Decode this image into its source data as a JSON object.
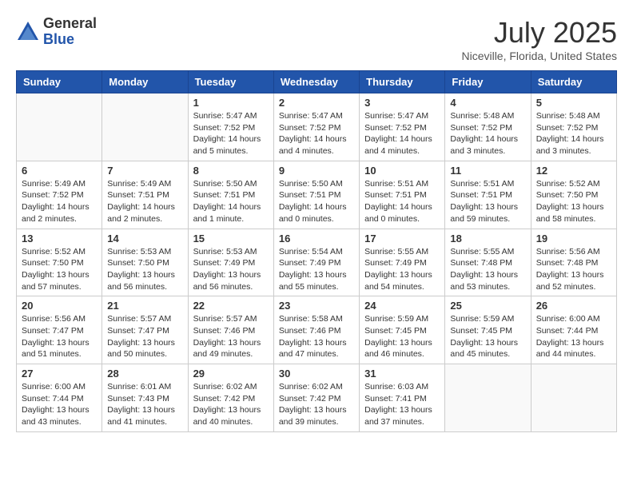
{
  "logo": {
    "general": "General",
    "blue": "Blue"
  },
  "title": {
    "month_year": "July 2025",
    "location": "Niceville, Florida, United States"
  },
  "days_of_week": [
    "Sunday",
    "Monday",
    "Tuesday",
    "Wednesday",
    "Thursday",
    "Friday",
    "Saturday"
  ],
  "weeks": [
    [
      {
        "day": "",
        "info": ""
      },
      {
        "day": "",
        "info": ""
      },
      {
        "day": "1",
        "info": "Sunrise: 5:47 AM\nSunset: 7:52 PM\nDaylight: 14 hours\nand 5 minutes."
      },
      {
        "day": "2",
        "info": "Sunrise: 5:47 AM\nSunset: 7:52 PM\nDaylight: 14 hours\nand 4 minutes."
      },
      {
        "day": "3",
        "info": "Sunrise: 5:47 AM\nSunset: 7:52 PM\nDaylight: 14 hours\nand 4 minutes."
      },
      {
        "day": "4",
        "info": "Sunrise: 5:48 AM\nSunset: 7:52 PM\nDaylight: 14 hours\nand 3 minutes."
      },
      {
        "day": "5",
        "info": "Sunrise: 5:48 AM\nSunset: 7:52 PM\nDaylight: 14 hours\nand 3 minutes."
      }
    ],
    [
      {
        "day": "6",
        "info": "Sunrise: 5:49 AM\nSunset: 7:52 PM\nDaylight: 14 hours\nand 2 minutes."
      },
      {
        "day": "7",
        "info": "Sunrise: 5:49 AM\nSunset: 7:51 PM\nDaylight: 14 hours\nand 2 minutes."
      },
      {
        "day": "8",
        "info": "Sunrise: 5:50 AM\nSunset: 7:51 PM\nDaylight: 14 hours\nand 1 minute."
      },
      {
        "day": "9",
        "info": "Sunrise: 5:50 AM\nSunset: 7:51 PM\nDaylight: 14 hours\nand 0 minutes."
      },
      {
        "day": "10",
        "info": "Sunrise: 5:51 AM\nSunset: 7:51 PM\nDaylight: 14 hours\nand 0 minutes."
      },
      {
        "day": "11",
        "info": "Sunrise: 5:51 AM\nSunset: 7:51 PM\nDaylight: 13 hours\nand 59 minutes."
      },
      {
        "day": "12",
        "info": "Sunrise: 5:52 AM\nSunset: 7:50 PM\nDaylight: 13 hours\nand 58 minutes."
      }
    ],
    [
      {
        "day": "13",
        "info": "Sunrise: 5:52 AM\nSunset: 7:50 PM\nDaylight: 13 hours\nand 57 minutes."
      },
      {
        "day": "14",
        "info": "Sunrise: 5:53 AM\nSunset: 7:50 PM\nDaylight: 13 hours\nand 56 minutes."
      },
      {
        "day": "15",
        "info": "Sunrise: 5:53 AM\nSunset: 7:49 PM\nDaylight: 13 hours\nand 56 minutes."
      },
      {
        "day": "16",
        "info": "Sunrise: 5:54 AM\nSunset: 7:49 PM\nDaylight: 13 hours\nand 55 minutes."
      },
      {
        "day": "17",
        "info": "Sunrise: 5:55 AM\nSunset: 7:49 PM\nDaylight: 13 hours\nand 54 minutes."
      },
      {
        "day": "18",
        "info": "Sunrise: 5:55 AM\nSunset: 7:48 PM\nDaylight: 13 hours\nand 53 minutes."
      },
      {
        "day": "19",
        "info": "Sunrise: 5:56 AM\nSunset: 7:48 PM\nDaylight: 13 hours\nand 52 minutes."
      }
    ],
    [
      {
        "day": "20",
        "info": "Sunrise: 5:56 AM\nSunset: 7:47 PM\nDaylight: 13 hours\nand 51 minutes."
      },
      {
        "day": "21",
        "info": "Sunrise: 5:57 AM\nSunset: 7:47 PM\nDaylight: 13 hours\nand 50 minutes."
      },
      {
        "day": "22",
        "info": "Sunrise: 5:57 AM\nSunset: 7:46 PM\nDaylight: 13 hours\nand 49 minutes."
      },
      {
        "day": "23",
        "info": "Sunrise: 5:58 AM\nSunset: 7:46 PM\nDaylight: 13 hours\nand 47 minutes."
      },
      {
        "day": "24",
        "info": "Sunrise: 5:59 AM\nSunset: 7:45 PM\nDaylight: 13 hours\nand 46 minutes."
      },
      {
        "day": "25",
        "info": "Sunrise: 5:59 AM\nSunset: 7:45 PM\nDaylight: 13 hours\nand 45 minutes."
      },
      {
        "day": "26",
        "info": "Sunrise: 6:00 AM\nSunset: 7:44 PM\nDaylight: 13 hours\nand 44 minutes."
      }
    ],
    [
      {
        "day": "27",
        "info": "Sunrise: 6:00 AM\nSunset: 7:44 PM\nDaylight: 13 hours\nand 43 minutes."
      },
      {
        "day": "28",
        "info": "Sunrise: 6:01 AM\nSunset: 7:43 PM\nDaylight: 13 hours\nand 41 minutes."
      },
      {
        "day": "29",
        "info": "Sunrise: 6:02 AM\nSunset: 7:42 PM\nDaylight: 13 hours\nand 40 minutes."
      },
      {
        "day": "30",
        "info": "Sunrise: 6:02 AM\nSunset: 7:42 PM\nDaylight: 13 hours\nand 39 minutes."
      },
      {
        "day": "31",
        "info": "Sunrise: 6:03 AM\nSunset: 7:41 PM\nDaylight: 13 hours\nand 37 minutes."
      },
      {
        "day": "",
        "info": ""
      },
      {
        "day": "",
        "info": ""
      }
    ]
  ]
}
